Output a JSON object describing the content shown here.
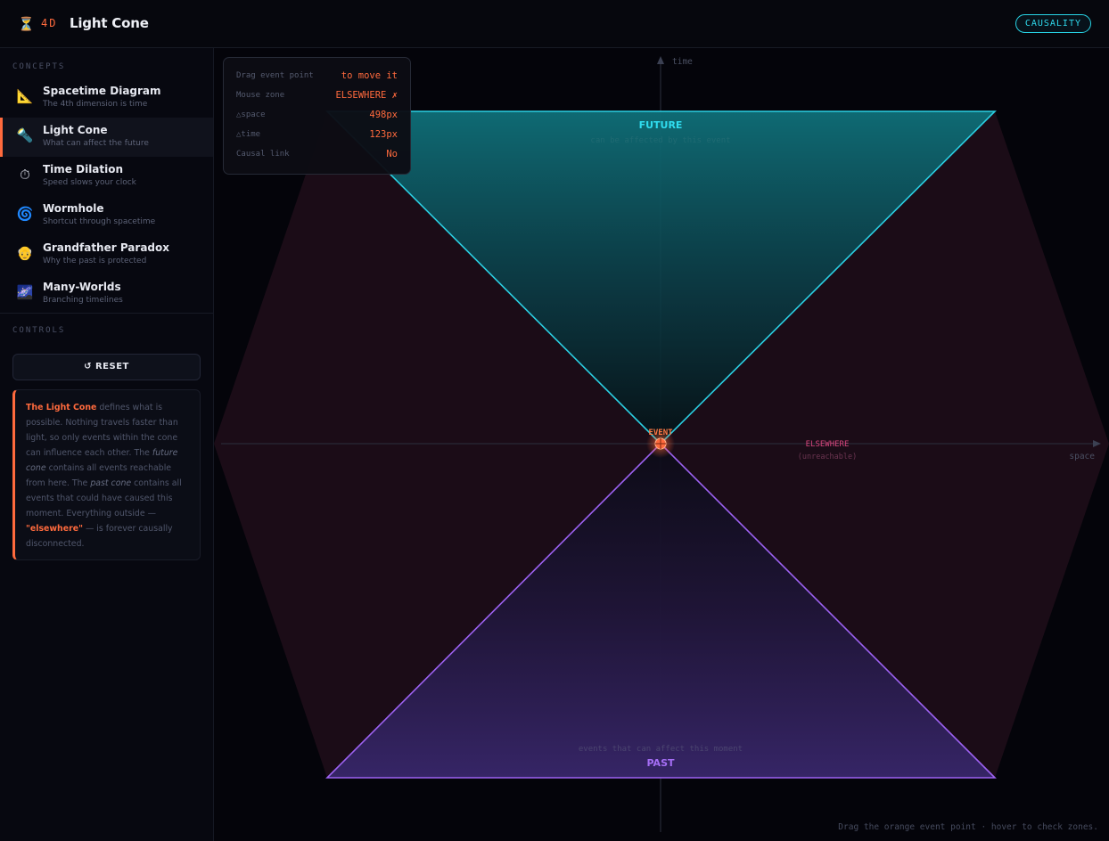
{
  "header": {
    "logo_icon": "hourglass-icon",
    "logo_mark": "4D",
    "title": "Light Cone",
    "badge": "CAUSALITY"
  },
  "sidebar": {
    "concepts_label": "CONCEPTS",
    "items": [
      {
        "label": "Spacetime Diagram",
        "sub": "The 4th dimension is time",
        "icon": "triangle-ruler-icon",
        "glyph": "📐"
      },
      {
        "label": "Light Cone",
        "sub": "What can affect the future",
        "icon": "flashlight-icon",
        "glyph": "🔦"
      },
      {
        "label": "Time Dilation",
        "sub": "Speed slows your clock",
        "icon": "stopwatch-icon",
        "glyph": "⏱"
      },
      {
        "label": "Wormhole",
        "sub": "Shortcut through spacetime",
        "icon": "spiral-icon",
        "glyph": "🌀"
      },
      {
        "label": "Grandfather Paradox",
        "sub": "Why the past is protected",
        "icon": "old-man-icon",
        "glyph": "👴"
      },
      {
        "label": "Many-Worlds",
        "sub": "Branching timelines",
        "icon": "branching-lines-icon",
        "glyph": "🌌"
      }
    ],
    "controls_label": "CONTROLS",
    "reset_label": "↺ RESET",
    "info": {
      "term": "The Light Cone",
      "t1": " defines what is possible. Nothing travels faster than light, so only events within the cone can influence each other. The ",
      "future": "future cone",
      "t2": " contains all events reachable from here. The ",
      "past": "past cone",
      "t3": " contains all events that could have caused this moment. Everything outside — ",
      "elsewhere": "\"elsewhere\"",
      "t4": " — is forever causally disconnected."
    }
  },
  "readout": {
    "rows": [
      {
        "key": "Drag event point",
        "value": "to move it"
      },
      {
        "key": "Mouse zone",
        "value": "ELSEWHERE ✗"
      },
      {
        "key": "△space",
        "value": "498px"
      },
      {
        "key": "△time",
        "value": "123px"
      },
      {
        "key": "Causal link",
        "value": "No"
      }
    ]
  },
  "diagram": {
    "time_axis_label": "time",
    "space_axis_label": "space",
    "future_label": "FUTURE",
    "future_sub": "can be affected by this event",
    "past_label": "PAST",
    "past_sub": "events that can affect this moment",
    "event_label": "EVENT",
    "elsewhere_label": "ELSEWHERE",
    "elsewhere_sub": "(unreachable)",
    "colors": {
      "future": "#22cfe0",
      "past": "#9a5cf0",
      "elsewhere": "#e0457a",
      "event": "#ff6a3d"
    }
  },
  "caption": "Drag the orange event point · hover to check zones."
}
